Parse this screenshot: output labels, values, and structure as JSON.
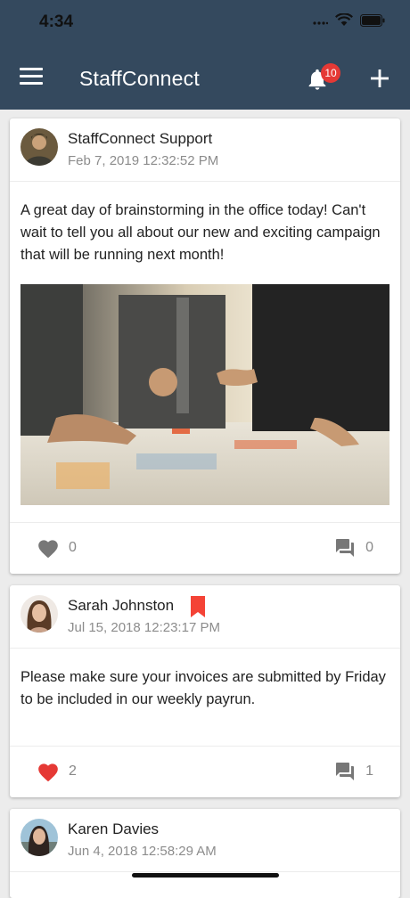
{
  "status_bar": {
    "time": "4:34"
  },
  "app": {
    "title": "StaffConnect",
    "notification_count": "10"
  },
  "colors": {
    "header": "#34495e",
    "like_active": "#e53935",
    "bookmark": "#f44336",
    "badge": "#e53935"
  },
  "posts": [
    {
      "author": "StaffConnect Support",
      "date": "Feb 7, 2019 12:32:52 PM",
      "text": "A great day of brainstorming in the office today! Can't wait to tell you all about our new and exciting campaign that will be running next month!",
      "likes": "0",
      "comments": "0",
      "liked": false,
      "bookmarked": false
    },
    {
      "author": "Sarah Johnston",
      "date": "Jul 15, 2018 12:23:17 PM",
      "text": "Please make sure your invoices are submitted by Friday to be included in our weekly payrun.",
      "likes": "2",
      "comments": "1",
      "liked": true,
      "bookmarked": true
    },
    {
      "author": "Karen Davies",
      "date": "Jun 4, 2018 12:58:29 AM"
    }
  ],
  "icons": [
    "menu-icon",
    "bell-icon",
    "plus-icon",
    "heart-icon",
    "comment-icon",
    "bookmark-icon",
    "wifi-icon",
    "battery-icon",
    "signal-icon"
  ]
}
